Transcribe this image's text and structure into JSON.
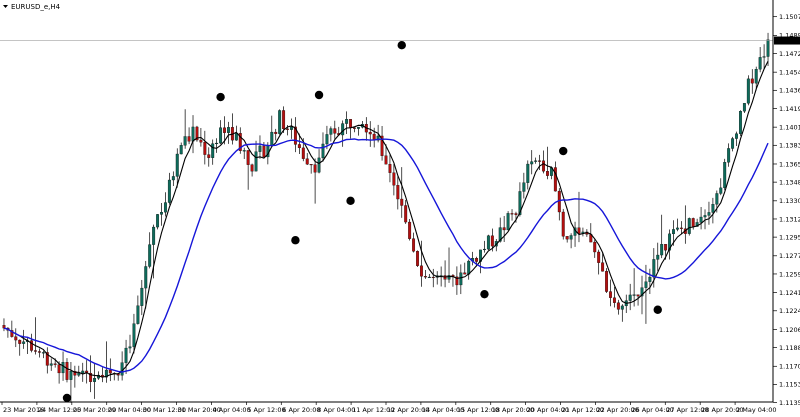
{
  "chart_title": "EURUSD_e,H4",
  "current_price": "1.14845",
  "colors": {
    "bull_body": "#0e6b5b",
    "bear_body": "#b30f0f",
    "wick": "#000000",
    "fast_ma": "#000000",
    "slow_ma": "#1616d9",
    "markers": "#000000",
    "price_box": "#000000"
  },
  "chart_data": {
    "type": "candlestick",
    "title": "EURUSD_e,H4",
    "ylim": [
      1.1138,
      1.1512
    ],
    "y_ticks": [
      "1.15075",
      "1.14895",
      "1.14720",
      "1.14540",
      "1.14365",
      "1.14190",
      "1.14010",
      "1.13835",
      "1.13655",
      "1.13480",
      "1.13300",
      "1.13125",
      "1.12950",
      "1.12770",
      "1.12595",
      "1.12415",
      "1.12240",
      "1.12060",
      "1.11885",
      "1.11705",
      "1.11530",
      "1.11355"
    ],
    "x_ticks": [
      "23 Mar 2016",
      "24 Mar 12:00",
      "25 Mar 20:00",
      "29 Mar 04:00",
      "30 Mar 12:00",
      "31 Mar 20:00",
      "4 Apr 04:00",
      "5 Apr 12:00",
      "6 Apr 20:00",
      "8 Apr 04:00",
      "11 Apr 12:00",
      "12 Apr 20:00",
      "14 Apr 04:00",
      "15 Apr 12:00",
      "18 Apr 20:00",
      "20 Apr 04:00",
      "21 Apr 12:00",
      "22 Apr 20:00",
      "26 Apr 04:00",
      "27 Apr 12:00",
      "28 Apr 20:00",
      "2 May 04:00"
    ],
    "price_path": [
      {
        "t": 0,
        "p": 1.121
      },
      {
        "t": 8,
        "p": 1.119
      },
      {
        "t": 15,
        "p": 1.117
      },
      {
        "t": 20,
        "p": 1.1158
      },
      {
        "t": 26,
        "p": 1.1168
      },
      {
        "t": 30,
        "p": 1.1165
      },
      {
        "t": 33,
        "p": 1.119
      },
      {
        "t": 36,
        "p": 1.1245
      },
      {
        "t": 39,
        "p": 1.131
      },
      {
        "t": 42,
        "p": 1.133
      },
      {
        "t": 46,
        "p": 1.1385
      },
      {
        "t": 49,
        "p": 1.1395
      },
      {
        "t": 53,
        "p": 1.1375
      },
      {
        "t": 56,
        "p": 1.14
      },
      {
        "t": 60,
        "p": 1.139
      },
      {
        "t": 64,
        "p": 1.1365
      },
      {
        "t": 68,
        "p": 1.1385
      },
      {
        "t": 71,
        "p": 1.141
      },
      {
        "t": 74,
        "p": 1.1395
      },
      {
        "t": 77,
        "p": 1.1375
      },
      {
        "t": 80,
        "p": 1.1365
      },
      {
        "t": 84,
        "p": 1.1395
      },
      {
        "t": 88,
        "p": 1.1405
      },
      {
        "t": 92,
        "p": 1.141
      },
      {
        "t": 96,
        "p": 1.1385
      },
      {
        "t": 99,
        "p": 1.136
      },
      {
        "t": 103,
        "p": 1.131
      },
      {
        "t": 107,
        "p": 1.126
      },
      {
        "t": 111,
        "p": 1.1252
      },
      {
        "t": 115,
        "p": 1.125
      },
      {
        "t": 119,
        "p": 1.127
      },
      {
        "t": 123,
        "p": 1.1285
      },
      {
        "t": 127,
        "p": 1.13
      },
      {
        "t": 131,
        "p": 1.1322
      },
      {
        "t": 134,
        "p": 1.136
      },
      {
        "t": 137,
        "p": 1.137
      },
      {
        "t": 140,
        "p": 1.1358
      },
      {
        "t": 143,
        "p": 1.13
      },
      {
        "t": 147,
        "p": 1.1295
      },
      {
        "t": 150,
        "p": 1.129
      },
      {
        "t": 153,
        "p": 1.126
      },
      {
        "t": 156,
        "p": 1.1225
      },
      {
        "t": 159,
        "p": 1.1228
      },
      {
        "t": 162,
        "p": 1.1245
      },
      {
        "t": 166,
        "p": 1.127
      },
      {
        "t": 170,
        "p": 1.1295
      },
      {
        "t": 174,
        "p": 1.1305
      },
      {
        "t": 178,
        "p": 1.1318
      },
      {
        "t": 182,
        "p": 1.1335
      },
      {
        "t": 186,
        "p": 1.139
      },
      {
        "t": 190,
        "p": 1.144
      },
      {
        "t": 193,
        "p": 1.1465
      },
      {
        "t": 195,
        "p": 1.1482
      }
    ],
    "candle_count": 195,
    "moving_averages": [
      {
        "period": 5,
        "color": "#000000"
      },
      {
        "period": 20,
        "color": "#1616d9"
      }
    ],
    "markers": [
      {
        "t": 16,
        "price": 1.114
      },
      {
        "t": 55,
        "price": 1.143
      },
      {
        "t": 74,
        "price": 1.1292
      },
      {
        "t": 80,
        "price": 1.1432
      },
      {
        "t": 88,
        "price": 1.133
      },
      {
        "t": 101,
        "price": 1.148
      },
      {
        "t": 122,
        "price": 1.124
      },
      {
        "t": 142,
        "price": 1.1378
      },
      {
        "t": 166,
        "price": 1.1225
      }
    ],
    "grid": false
  }
}
